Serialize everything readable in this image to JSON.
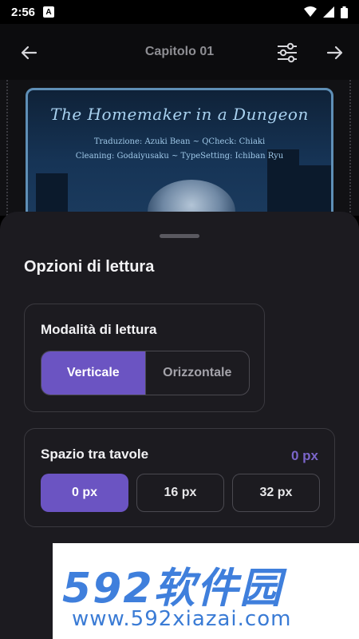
{
  "status_bar": {
    "time": "2:56",
    "notification_glyph": "A",
    "icons": [
      "wifi-icon",
      "signal-icon",
      "battery-icon"
    ]
  },
  "top_bar": {
    "title": "Capitolo 01",
    "icons": [
      "arrow-left-icon",
      "sliders-icon",
      "arrow-right-icon"
    ]
  },
  "page_preview": {
    "title": "The Homemaker in a Dungeon",
    "credits_line_1": "Traduzione: Azuki Bean ~ QCheck: Chiaki",
    "credits_line_2": "Cleaning: Godaiyusaku ~ TypeSetting: Ichiban Ryu"
  },
  "sheet": {
    "title": "Opzioni di lettura",
    "reading_mode": {
      "label": "Modalità di lettura",
      "options": [
        "Verticale",
        "Orizzontale"
      ],
      "selected": "Verticale"
    },
    "spacing": {
      "label": "Spazio tra tavole",
      "current_value": "0 px",
      "options": [
        "0 px",
        "16 px",
        "32 px"
      ],
      "selected": "0 px"
    }
  },
  "watermark": {
    "logo_text": "592软件园",
    "url": "www.592xiazai.com"
  },
  "colors": {
    "accent": "#6b54c2",
    "sheet_bg": "#1c1b20",
    "page_frame": "#5f8fb6"
  }
}
